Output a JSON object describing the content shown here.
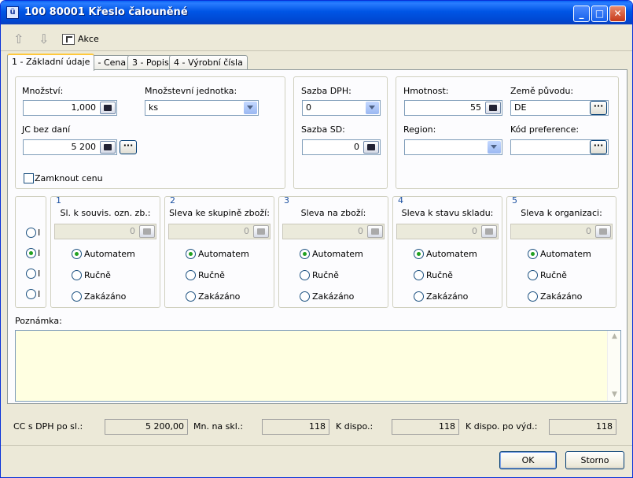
{
  "window": {
    "title": "100 80001 Křeslo čalouněné",
    "app_icon": "doc-icon"
  },
  "toolbar": {
    "akce_label": "Akce"
  },
  "tabs": [
    "1 - Základní údaje",
    "2 - Cena",
    "3 - Popis",
    "4 - Výrobní čísla"
  ],
  "main": {
    "mnozstvi_label": "Množství:",
    "mnozstvi_value": "1,000",
    "jednotka_label": "Množstevní jednotka:",
    "jednotka_value": "ks",
    "jc_label": "JC bez daní",
    "jc_value": "5 200",
    "zamknout_label": "Zamknout cenu",
    "sazba_dph_label": "Sazba DPH:",
    "sazba_dph_value": "0",
    "sazba_sd_label": "Sazba SD:",
    "sazba_sd_value": "0",
    "hmotnost_label": "Hmotnost:",
    "hmotnost_value": "55",
    "zeme_label": "Země původu:",
    "zeme_value": "DE",
    "region_label": "Region:",
    "region_value": "",
    "kod_pref_label": "Kód preference:",
    "kod_pref_value": ""
  },
  "level_radios": [
    {
      "label": "I",
      "checked": false
    },
    {
      "label": "I",
      "checked": true
    },
    {
      "label": "I",
      "checked": false
    },
    {
      "label": "I",
      "checked": false
    }
  ],
  "discount_groups": [
    {
      "number": "1",
      "title": "Sl. k souvis. ozn. zb.:",
      "value": "0",
      "options": [
        "Automatem",
        "Ručně",
        "Zakázáno"
      ],
      "selected": 0
    },
    {
      "number": "2",
      "title": "Sleva ke skupině zboží:",
      "value": "0",
      "options": [
        "Automatem",
        "Ručně",
        "Zakázáno"
      ],
      "selected": 0
    },
    {
      "number": "3",
      "title": "Sleva na zboží:",
      "value": "0",
      "options": [
        "Automatem",
        "Ručně",
        "Zakázáno"
      ],
      "selected": 0
    },
    {
      "number": "4",
      "title": "Sleva k stavu skladu:",
      "value": "0",
      "options": [
        "Automatem",
        "Ručně",
        "Zakázáno"
      ],
      "selected": 0
    },
    {
      "number": "5",
      "title": "Sleva k organizaci:",
      "value": "0",
      "options": [
        "Automatem",
        "Ručně",
        "Zakázáno"
      ],
      "selected": 0
    }
  ],
  "poznamka": {
    "label": "Poznámka:",
    "value": ""
  },
  "status": {
    "cc_label": "CC s DPH po sl.:",
    "cc_value": "5 200,00",
    "mn_label": "Mn. na skl.:",
    "mn_value": "118",
    "kdispo_label": "K dispo.:",
    "kdispo_value": "118",
    "kdispo_vyd_label": "K dispo. po výd.:",
    "kdispo_vyd_value": "118"
  },
  "buttons": {
    "ok": "OK",
    "storno": "Storno"
  },
  "colors": {
    "titlebar": "#0055e5",
    "notes_bg": "#ffffe1",
    "panel_bg": "#ece9d8",
    "group_number": "#1a4fa0",
    "radio_dot": "#21a121"
  }
}
